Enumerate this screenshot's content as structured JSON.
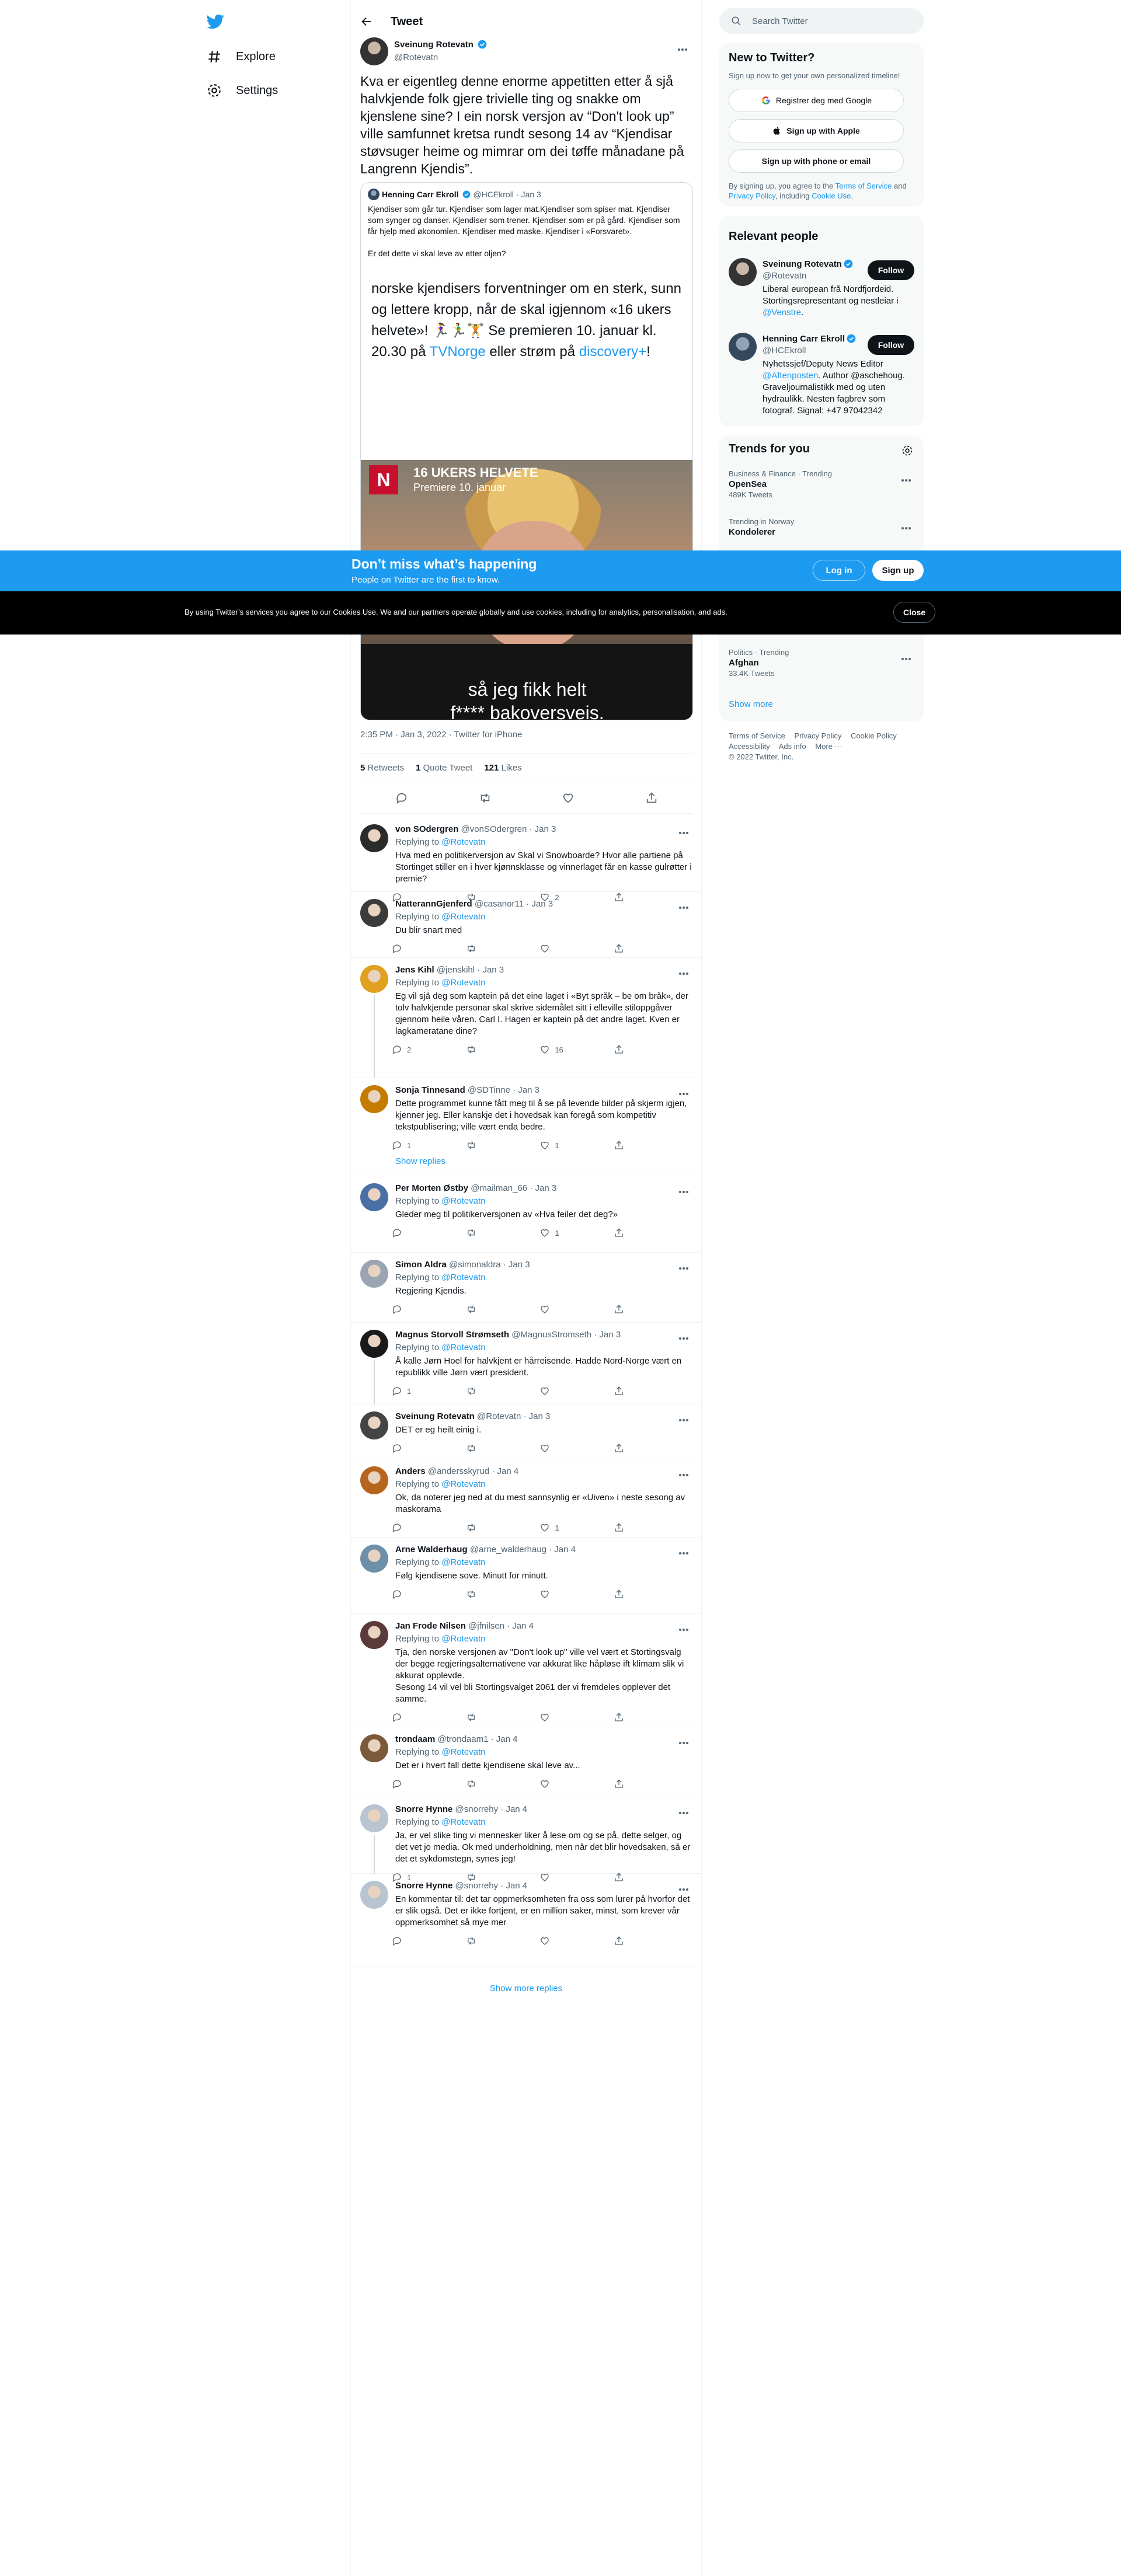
{
  "nav": {
    "items": [
      {
        "label": "Explore",
        "icon": "hashtag-icon"
      },
      {
        "label": "Settings",
        "icon": "gear-icon"
      }
    ]
  },
  "header": {
    "title": "Tweet"
  },
  "tweet": {
    "author_name": "Sveinung Rotevatn",
    "author_handle": "@Rotevatn",
    "text": "Kva er eigentleg denne enorme appetitten etter å sjå halvkjende folk gjere trivielle ting og snakke om kjenslene sine? I ein norsk versjon av “Don't look up” ville samfunnet kretsa rundt sesong 14 av “Kjendisar støvsuger heime og mimrar om dei tøffe månadane på Langrenn Kjendis”.",
    "quote": {
      "author_name": "Henning Carr Ekroll",
      "author_handle": "@HCEkroll",
      "date": "· Jan 3",
      "text": "Kjendiser som går tur. Kjendiser som lager mat.Kjendiser som spiser mat. Kjendiser som synger og danser. Kjendiser som trener. Kjendiser som er på gård. Kjendiser som får hjelp med økonomien. Kjendiser med maske. Kjendiser i «Forsvaret».\n\nEr det dette vi skal leve av etter oljen?",
      "embed_text_a": "norske kjendisers forventninger om en sterk, sunn og lettere kropp, når de skal igjennom «16 ukers helvete»! 🏃‍♀️🏃‍♂️🏋️ Se premieren 10. januar kl. 20.30 på ",
      "embed_link_tvnorge": "TVNorge",
      "embed_text_b": " eller strøm på ",
      "embed_link_discovery": "discovery+",
      "embed_text_c": "!",
      "video_title": "16 UKERS HELVETE",
      "video_subtitle": "Premiere 10. januar",
      "video_caption_1": "så jeg fikk helt",
      "video_caption_2": "f**** bakoversveis."
    },
    "meta": "2:35 PM · Jan 3, 2022 · Twitter for iPhone",
    "retweets": "5",
    "retweets_label": "Retweets",
    "quotes": "1",
    "quotes_label": "Quote Tweet",
    "likes": "121",
    "likes_label": "Likes"
  },
  "replies": [
    {
      "name": "von SOdergren",
      "handle": "@vonSOdergren",
      "date": "· Jan 3",
      "replying": "Replying to",
      "to": "@Rotevatn",
      "text": "Hva med en politikerversjon av Skal vi Snowboarde? Hvor alle partiene på Stortinget stiller en i hver kjønnsklasse og vinnerlaget får en kasse gulrøtter i premie?",
      "replies": "",
      "retweets": "",
      "likes": "2"
    },
    {
      "name": "NatterannGjenferd",
      "handle": "@casanor11",
      "date": "· Jan 3",
      "replying": "Replying to",
      "to": "@Rotevatn",
      "text": "Du blir snart med",
      "replies": "",
      "retweets": "",
      "likes": ""
    },
    {
      "name": "Jens Kihl",
      "handle": "@jenskihl",
      "date": "· Jan 3",
      "replying": "Replying to",
      "to": "@Rotevatn",
      "text": "Eg vil sjå deg som kaptein på det eine laget i «Byt språk – be om bråk», der tolv halvkjende personar skal skrive sidemålet sitt i elleville stiloppgåver gjennom  heile våren. Carl I. Hagen er kaptein på det andre laget. Kven er lagkameratane dine?",
      "replies": "2",
      "retweets": "",
      "likes": "16"
    },
    {
      "name": "Sonja Tinnesand",
      "handle": "@SDTinne",
      "date": "· Jan 3",
      "replying": "",
      "to": "",
      "text": "Dette programmet kunne fått meg til å se på levende bilder på skjerm igjen, kjenner jeg. Eller kanskje det i hovedsak kan foregå som kompetitiv tekstpublisering; ville vært enda bedre.",
      "replies": "1",
      "retweets": "",
      "likes": "1"
    },
    {
      "name": "Per Morten Østby",
      "handle": "@mailman_66",
      "date": "· Jan 3",
      "replying": "Replying to",
      "to": "@Rotevatn",
      "text": "Gleder meg til politikerversjonen av «Hva feiler det deg?»",
      "replies": "",
      "retweets": "",
      "likes": "1"
    },
    {
      "name": "Simon Aldra",
      "handle": "@simonaldra",
      "date": "· Jan 3",
      "replying": "Replying to",
      "to": "@Rotevatn",
      "text": "Regjering Kjendis.",
      "replies": "",
      "retweets": "",
      "likes": ""
    },
    {
      "name": "Magnus Storvoll Strømseth",
      "handle": "@MagnusStromseth",
      "date": "· Jan 3",
      "replying": "Replying to",
      "to": "@Rotevatn",
      "text": "Å kalle Jørn Hoel for halvkjent er hårreisende. Hadde Nord-Norge vært en republikk ville Jørn vært president.",
      "replies": "1",
      "retweets": "",
      "likes": ""
    },
    {
      "name": "Sveinung Rotevatn",
      "handle": "@Rotevatn",
      "date": "· Jan 3",
      "replying": "",
      "to": "",
      "text": "DET er eg heilt einig i.",
      "replies": "",
      "retweets": "",
      "likes": ""
    },
    {
      "name": "Anders",
      "handle": "@andersskyrud",
      "date": "· Jan 4",
      "replying": "Replying to",
      "to": "@Rotevatn",
      "text": "Ok, da noterer jeg ned at du mest sannsynlig er «Uiven» i neste sesong av maskorama",
      "replies": "",
      "retweets": "",
      "likes": "1"
    },
    {
      "name": "Arne Walderhaug",
      "handle": "@arne_walderhaug",
      "date": "· Jan 4",
      "replying": "Replying to",
      "to": "@Rotevatn",
      "text": "Følg kjendisene sove. Minutt for minutt.",
      "replies": "",
      "retweets": "",
      "likes": ""
    },
    {
      "name": "Jan Frode Nilsen",
      "handle": "@jfnilsen",
      "date": "· Jan 4",
      "replying": "Replying to",
      "to": "@Rotevatn",
      "text": "Tja, den norske versjonen av \"Don't look up\" ville vel vært et Stortingsvalg der begge regjeringsalternativene var akkurat like håpløse ift klimam slik vi akkurat opplevde.\nSesong 14 vil vel bli Stortingsvalget 2061 der vi fremdeles opplever det samme.",
      "replies": "",
      "retweets": "",
      "likes": ""
    },
    {
      "name": "trondaam",
      "handle": "@trondaam1",
      "date": "· Jan 4",
      "replying": "Replying to",
      "to": "@Rotevatn",
      "text": "Det er i hvert fall dette kjendisene skal leve av...",
      "replies": "",
      "retweets": "",
      "likes": ""
    },
    {
      "name": "Snorre Hynne",
      "handle": "@snorrehy",
      "date": "· Jan 4",
      "replying": "Replying to",
      "to": "@Rotevatn",
      "text": "Ja, er vel slike ting vi mennesker liker å lese om og se på, dette selger, og det vet jo media. Ok med underholdning, men når det blir hovedsaken, så er det et sykdomstegn, synes jeg!",
      "replies": "1",
      "retweets": "",
      "likes": ""
    },
    {
      "name": "Snorre Hynne",
      "handle": "@snorrehy",
      "date": "· Jan 4",
      "replying": "",
      "to": "",
      "text": "En kommentar til: det tar oppmerksomheten fra oss som lurer på hvorfor det er slik også. Det er ikke fortjent, er en million saker, minst, som krever vår oppmerksomhet så mye mer",
      "replies": "",
      "retweets": "",
      "likes": ""
    }
  ],
  "show_replies": "Show replies",
  "show_more_replies": "Show more replies",
  "sidebar": {
    "search_placeholder": "Search Twitter",
    "new_title": "New to Twitter?",
    "new_sub": "Sign up now to get your own personalized timeline!",
    "google_btn": "Registrer deg med Google",
    "apple_btn": "Sign up with Apple",
    "phone_btn": "Sign up with phone or email",
    "terms_a": "By signing up, you agree to the ",
    "terms_link1": "Terms of Service",
    "terms_b": " and ",
    "terms_link2": "Privacy Policy",
    "terms_c": ", including ",
    "terms_link3": "Cookie Use",
    "terms_d": ".",
    "relevant_title": "Relevant people",
    "people": [
      {
        "name": "Sveinung Rotevatn",
        "handle": "@Rotevatn",
        "bio": "Liberal european frå Nordfjordeid. Stortingsrepresentant og nestleiar i ",
        "bio_link": "@Venstre",
        "bio_end": ".",
        "follow": "Follow"
      },
      {
        "name": "Henning Carr Ekroll",
        "handle": "@HCEkroll",
        "bio": "Nyhetssjef/Deputy News Editor ",
        "bio_link": "@Aftenposten",
        "bio_end": ". Author @aschehoug. Graveljournalistikk med og uten hydraulikk. Nesten fagbrev som fotograf. Signal: +47 97042342",
        "follow": "Follow"
      }
    ],
    "trends_title": "Trends for you",
    "trends": [
      {
        "ctx": "Business & Finance · Trending",
        "name": "OpenSea",
        "count": "489K Tweets"
      },
      {
        "ctx": "Trending in Norway",
        "name": "Kondolerer",
        "count": ""
      },
      {
        "ctx": "Politics · Trending",
        "name": "Afghan",
        "count": "33.4K Tweets"
      }
    ],
    "show_more": "Show more",
    "footer": [
      "Terms of Service",
      "Privacy Policy",
      "Cookie Policy",
      "Accessibility",
      "Ads info",
      "More ···",
      "© 2022 Twitter, Inc."
    ]
  },
  "signup_bar": {
    "title": "Don’t miss what’s happening",
    "sub": "People on Twitter are the first to know.",
    "login": "Log in",
    "signup": "Sign up"
  },
  "cookie_bar": {
    "text": "By using Twitter’s services you agree to our Cookies Use. We and our partners operate globally and use cookies, including for analytics, personalisation, and ads.",
    "close": "Close"
  },
  "colors": {
    "accent": "#1d9bf0",
    "text": "#0f1419",
    "muted": "#536471",
    "border": "#eff3f4"
  }
}
